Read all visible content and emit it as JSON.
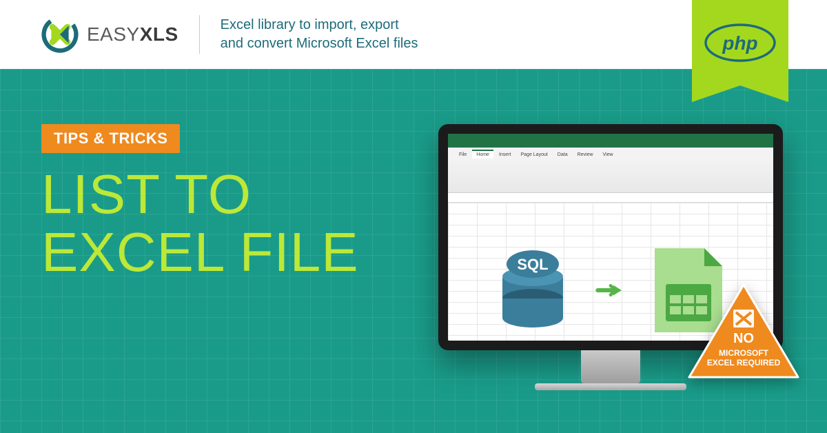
{
  "header": {
    "logo_text_prefix": "EASY",
    "logo_text_suffix": "XLS",
    "tagline_line1": "Excel library to import, export",
    "tagline_line2": "and convert Microsoft Excel files"
  },
  "ribbon": {
    "tech_label": "php"
  },
  "content": {
    "tips_label": "TIPS & TRICKS",
    "headline_line1": "LIST TO",
    "headline_line2": "EXCEL FILE"
  },
  "monitor": {
    "sql_label": "SQL",
    "excel_tabs": [
      "File",
      "Home",
      "Insert",
      "Page Layout",
      "Data",
      "Review",
      "View"
    ]
  },
  "badge": {
    "line_no": "NO",
    "line2": "MICROSOFT",
    "line3": "EXCEL REQUIRED"
  },
  "colors": {
    "accent_green": "#a4d81f",
    "bg_teal": "#1a9b89",
    "orange": "#ef8a1f",
    "lime_text": "#bce838"
  }
}
